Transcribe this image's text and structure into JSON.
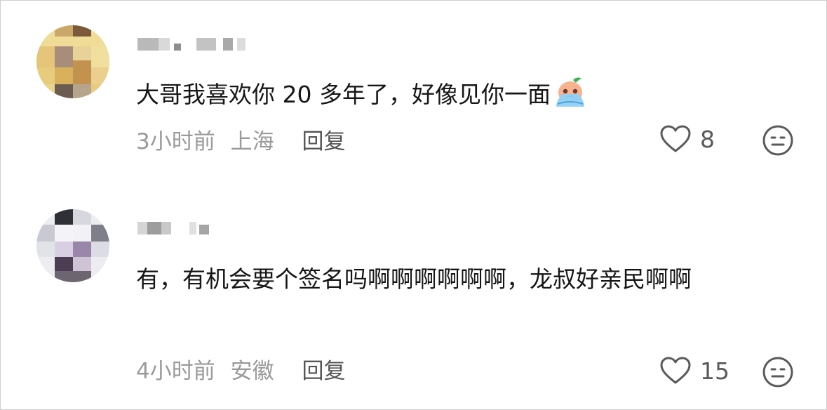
{
  "comments": [
    {
      "text": "大哥我喜欢你 20 多年了，好像见你一面",
      "time": "3小时前",
      "location": "上海",
      "reply_label": "回复",
      "likes": "8",
      "emoji": "crying-peach-emoji"
    },
    {
      "text": "有，有机会要个签名吗啊啊啊啊啊啊，龙叔好亲民啊啊",
      "time": "4小时前",
      "location": "安徽",
      "reply_label": "回复",
      "likes": "15"
    }
  ],
  "icons": {
    "like": "heart-outline-icon",
    "dislike": "neutral-face-icon"
  },
  "colors": {
    "text": "#161616",
    "meta": "#9a9a9a",
    "reply": "#555555"
  }
}
